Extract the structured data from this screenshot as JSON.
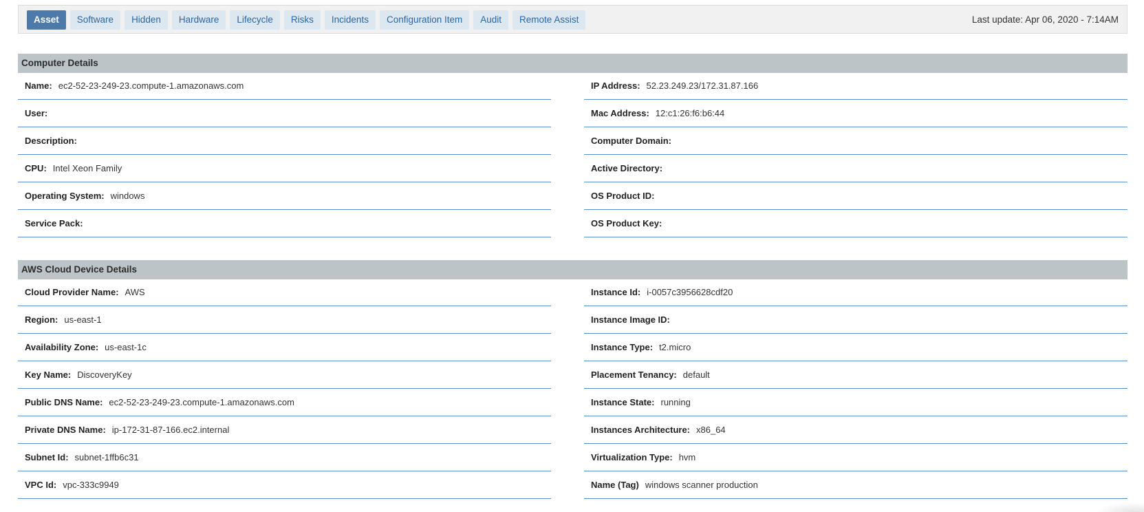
{
  "tabs": [
    {
      "label": "Asset",
      "active": true
    },
    {
      "label": "Software"
    },
    {
      "label": "Hidden"
    },
    {
      "label": "Hardware"
    },
    {
      "label": "Lifecycle"
    },
    {
      "label": "Risks"
    },
    {
      "label": "Incidents"
    },
    {
      "label": "Configuration Item"
    },
    {
      "label": "Audit"
    },
    {
      "label": "Remote Assist"
    }
  ],
  "last_update": "Last update: Apr 06, 2020 - 7:14AM",
  "computer": {
    "title": "Computer Details",
    "left": [
      {
        "label": "Name:",
        "value": "ec2-52-23-249-23.compute-1.amazonaws.com"
      },
      {
        "label": "User:",
        "value": ""
      },
      {
        "label": "Description:",
        "value": ""
      },
      {
        "label": "CPU:",
        "value": "Intel Xeon Family"
      },
      {
        "label": "Operating System:",
        "value": "windows"
      },
      {
        "label": "Service Pack:",
        "value": ""
      }
    ],
    "right": [
      {
        "label": "IP Address:",
        "value": "52.23.249.23/172.31.87.166"
      },
      {
        "label": "Mac Address:",
        "value": "12:c1:26:f6:b6:44"
      },
      {
        "label": "Computer Domain:",
        "value": ""
      },
      {
        "label": "Active Directory:",
        "value": ""
      },
      {
        "label": "OS Product ID:",
        "value": ""
      },
      {
        "label": "OS Product Key:",
        "value": ""
      }
    ]
  },
  "aws": {
    "title": "AWS Cloud Device Details",
    "left": [
      {
        "label": "Cloud Provider Name:",
        "value": "AWS"
      },
      {
        "label": "Region:",
        "value": "us-east-1"
      },
      {
        "label": "Availability Zone:",
        "value": "us-east-1c"
      },
      {
        "label": "Key Name:",
        "value": "DiscoveryKey"
      },
      {
        "label": "Public DNS Name:",
        "value": "ec2-52-23-249-23.compute-1.amazonaws.com"
      },
      {
        "label": "Private DNS Name:",
        "value": "ip-172-31-87-166.ec2.internal"
      },
      {
        "label": "Subnet Id:",
        "value": "subnet-1ffb6c31"
      },
      {
        "label": "VPC Id:",
        "value": "vpc-333c9949"
      }
    ],
    "right": [
      {
        "label": "Instance Id:",
        "value": "i-0057c3956628cdf20"
      },
      {
        "label": "Instance Image ID:",
        "value": ""
      },
      {
        "label": "Instance Type:",
        "value": "t2.micro"
      },
      {
        "label": "Placement Tenancy:",
        "value": "default"
      },
      {
        "label": "Instance State:",
        "value": "running"
      },
      {
        "label": "Instances Architecture:",
        "value": "x86_64"
      },
      {
        "label": "Virtualization Type:",
        "value": "hvm"
      },
      {
        "label": "Name (Tag)",
        "value": "windows scanner production"
      }
    ]
  }
}
